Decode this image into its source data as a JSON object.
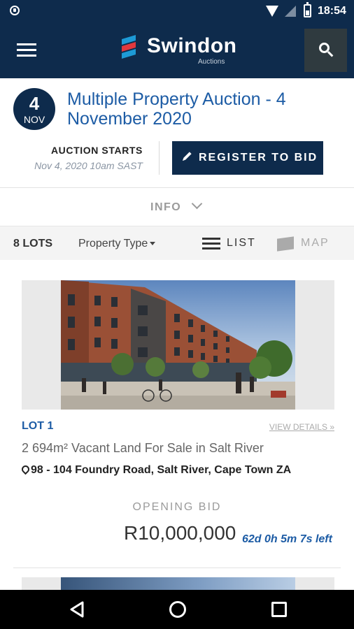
{
  "status_bar": {
    "time": "18:54",
    "icons": [
      "shield-icon",
      "wifi-icon",
      "no-signal-icon",
      "battery-charging-icon"
    ]
  },
  "app_bar": {
    "logo_name": "Swindon",
    "logo_sub": "Auctions",
    "menu_icon": "hamburger-menu-icon",
    "search_icon": "search-icon"
  },
  "auction": {
    "date_day": "4",
    "date_month": "NOV",
    "title": "Multiple Property Auction - 4 November 2020",
    "starts_label": "AUCTION STARTS",
    "starts_value": "Nov 4, 2020 10am SAST",
    "register_label": "REGISTER TO BID"
  },
  "info": {
    "label": "INFO"
  },
  "filters": {
    "lots_count": "8 LOTS",
    "property_type_label": "Property Type",
    "list_label": "LIST",
    "map_label": "MAP",
    "active_view": "list"
  },
  "lots": [
    {
      "lot_number": "LOT 1",
      "view_details": "VIEW DETAILS »",
      "title": "2 694m² Vacant Land For Sale in Salt River",
      "address": "98 - 104 Foundry Road, Salt River, Cape Town ZA",
      "opening_bid_label": "OPENING BID",
      "opening_bid_value": "R10,000,000",
      "time_left": "62d 0h 5m 7s left"
    }
  ],
  "colors": {
    "brand_navy": "#0e2b4c",
    "accent_blue": "#1d5ca5",
    "logo_red": "#e0393e",
    "logo_blue": "#1d9ad6"
  },
  "nav_bar": {
    "icons": [
      "back-icon",
      "home-icon",
      "recents-icon"
    ]
  }
}
